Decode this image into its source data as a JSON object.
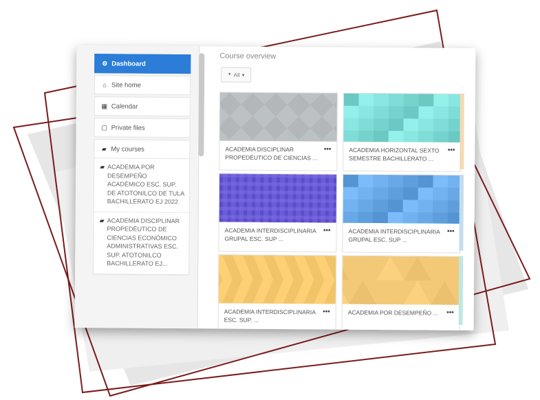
{
  "sidebar": {
    "nav": [
      {
        "icon": "dashboard-icon",
        "glyph": "⚙",
        "label": "Dashboard",
        "active": true
      },
      {
        "icon": "home-icon",
        "glyph": "⌂",
        "label": "Site home",
        "active": false
      },
      {
        "icon": "calendar-icon",
        "glyph": "▦",
        "label": "Calendar",
        "active": false
      },
      {
        "icon": "file-icon",
        "glyph": "▢",
        "label": "Private files",
        "active": false
      },
      {
        "icon": "graduation-cap-icon",
        "glyph": "▰",
        "label": "My courses",
        "active": false
      }
    ],
    "courses": [
      {
        "label": "ACADEMIA POR DESEMPEÑO ACADÉMICO ESC. SUP. DE ATOTONILCO DE TULA BACHILLERATO EJ 2022"
      },
      {
        "label": "ACADEMIA DISCIPLINAR PROPEDÉUTICO DE CIENCIAS ECONÓMICO ADMINISTRATIVAS ESC. SUP. ATOTONILCO BACHILLERATO EJ..."
      }
    ]
  },
  "main": {
    "title": "Course overview",
    "filter_label": "All",
    "filter_glyph": "▼"
  },
  "course_cards": [
    {
      "name": "ACADEMIA DISCIPLINAR PROPEDÉUTICO DE CIENCIAS ...",
      "color": "#b3b7ba",
      "pattern": "diamond"
    },
    {
      "name": "ACADEMIA HORIZONTAL SEXTO SEMESTRE BACHILLERATO ...",
      "color": "#7fdcd6",
      "pattern": "squares"
    },
    {
      "name": "ACADEMIA INTERDISCIPLINARIA GRUPAL ESC. SUP ...",
      "color": "#6a5bd6",
      "pattern": "plaid"
    },
    {
      "name": "ACADEMIA INTERDISCIPLINARIA GRUPAL ESC. SUP ...",
      "color": "#68a8e6",
      "pattern": "squares"
    },
    {
      "name": "ACADEMIA INTERDISCIPLINARIA ESC. SUP. ...",
      "color": "#f2c46a",
      "pattern": "chevron"
    },
    {
      "name": "ACADEMIA POR DESEMPEÑO ...",
      "color": "#f3c978",
      "pattern": "triangles"
    }
  ],
  "card_menu_glyph": "•••"
}
